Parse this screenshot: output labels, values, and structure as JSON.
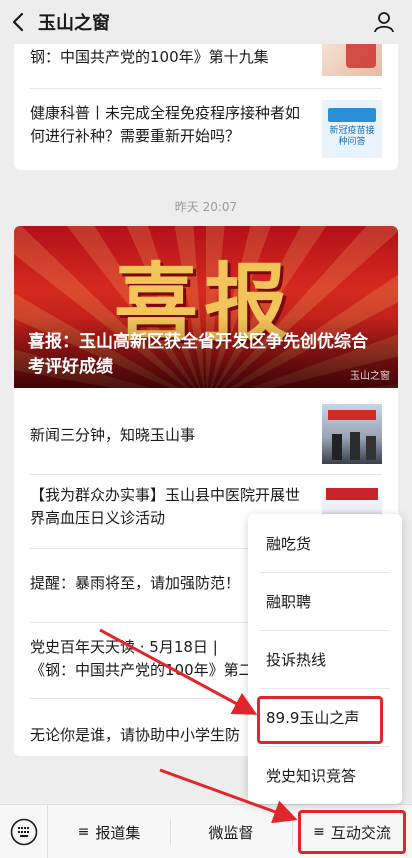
{
  "header": {
    "title": "玉山之窗"
  },
  "card_top": {
    "items": [
      {
        "text": "钢：中国共产党的100年》第十九集"
      },
      {
        "text": "健康科普丨未完成全程免疫程序接种者如何进行补种？需要重新开始吗？"
      }
    ],
    "thumb2_text": "新冠疫苗接种问答"
  },
  "timestamp": "昨天 20:07",
  "card_main": {
    "banner_art": "喜报",
    "headline": "喜报：玉山高新区获全省开发区争先创优综合考评好成绩",
    "watermark": "玉山之窗",
    "items": [
      {
        "text": "新闻三分钟，知晓玉山事"
      },
      {
        "text": "【我为群众办实事】玉山县中医院开展世界高血压日义诊活动"
      },
      {
        "text": "提醒：暴雨将至，请加强防范！"
      },
      {
        "text": "党史百年天天读 · 5月18日 |《钢：中国共产党的100年》第二"
      },
      {
        "text": "无论你是谁，请协助中小学生防"
      }
    ]
  },
  "popup_menu": {
    "items": [
      "融吃货",
      "融职聘",
      "投诉热线",
      "89.9玉山之声",
      "党史知识竞答"
    ],
    "highlighted_index": 3
  },
  "bottom_menu": {
    "tabs": [
      "报道集",
      "微监督",
      "互动交流"
    ],
    "active_index": 2
  },
  "colors": {
    "annotation": "#e0262b",
    "banner_red": "#c41a1c",
    "gold": "#f3c45a"
  }
}
